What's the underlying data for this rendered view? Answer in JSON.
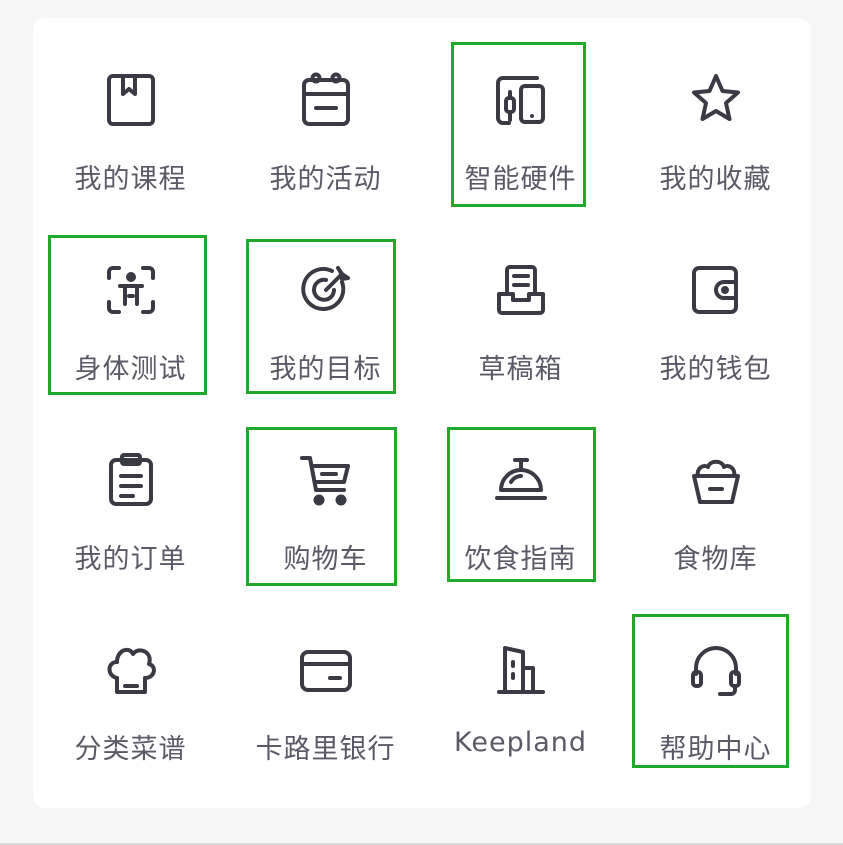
{
  "items": [
    {
      "label": "我的课程",
      "icon": "book-icon"
    },
    {
      "label": "我的活动",
      "icon": "calendar-icon"
    },
    {
      "label": "智能硬件",
      "icon": "devices-icon"
    },
    {
      "label": "我的收藏",
      "icon": "star-icon"
    },
    {
      "label": "身体测试",
      "icon": "body-scan-icon"
    },
    {
      "label": "我的目标",
      "icon": "target-icon"
    },
    {
      "label": "草稿箱",
      "icon": "drafts-tray-icon"
    },
    {
      "label": "我的钱包",
      "icon": "wallet-icon"
    },
    {
      "label": "我的订单",
      "icon": "clipboard-icon"
    },
    {
      "label": "购物车",
      "icon": "shopping-cart-icon"
    },
    {
      "label": "饮食指南",
      "icon": "cloche-icon"
    },
    {
      "label": "食物库",
      "icon": "food-basket-icon"
    },
    {
      "label": "分类菜谱",
      "icon": "chef-hat-icon"
    },
    {
      "label": "卡路里银行",
      "icon": "bank-card-icon"
    },
    {
      "label": "Keepland",
      "icon": "buildings-icon"
    },
    {
      "label": "帮助中心",
      "icon": "headset-icon"
    }
  ],
  "colors": {
    "icon": "#3a3a44",
    "label": "#5a5a66",
    "highlight": "#1fa82a",
    "card": "#ffffff",
    "page": "#f6f6f7"
  }
}
